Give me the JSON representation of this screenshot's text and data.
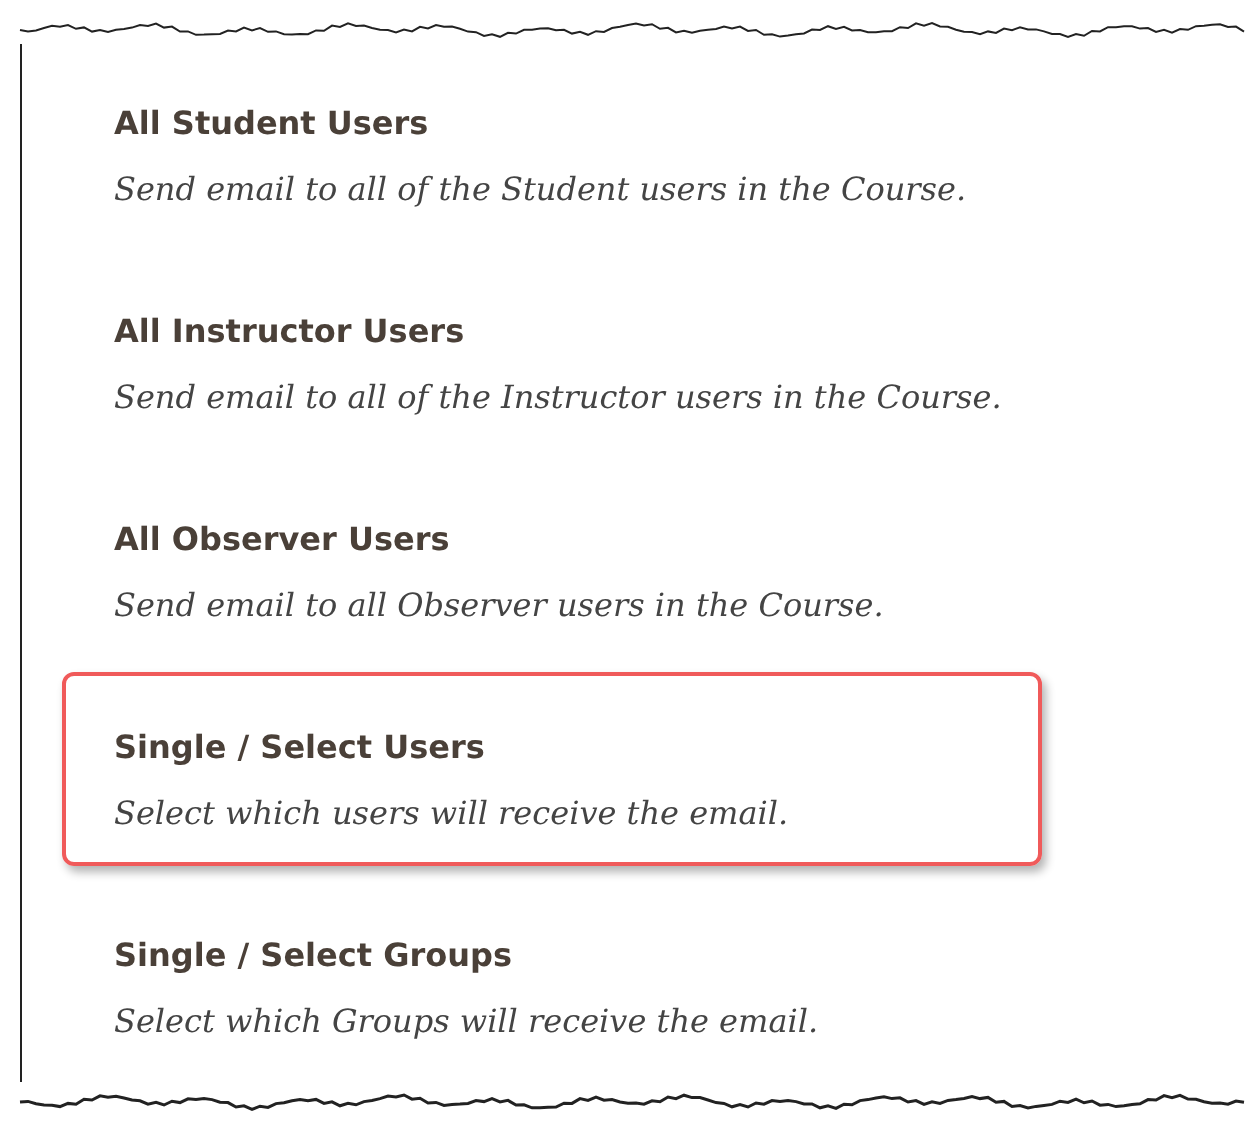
{
  "options": [
    {
      "title": "All Student Users",
      "description": "Send email to all of the Student users in the Course.",
      "highlighted": false
    },
    {
      "title": "All Instructor Users",
      "description": "Send email to all of the Instructor users in the Course.",
      "highlighted": false
    },
    {
      "title": "All Observer Users",
      "description": "Send email to all Observer users in the Course.",
      "highlighted": false
    },
    {
      "title": "Single / Select Users",
      "description": "Select which users will receive the email.",
      "highlighted": true
    },
    {
      "title": "Single / Select Groups",
      "description": "Select which Groups will receive the email.",
      "highlighted": false
    }
  ]
}
